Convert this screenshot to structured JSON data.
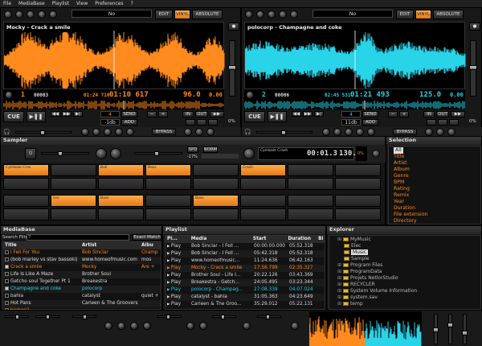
{
  "menu": [
    "File",
    "MediaBase",
    "Playlist",
    "View",
    "Preferences",
    "?"
  ],
  "colors": {
    "deck1": "#ff8a1e",
    "deck2": "#29d3e8"
  },
  "deck1": {
    "title": "Mocky - Crack a smile",
    "number": "1",
    "track_counter": "00003",
    "remain": "01:24 710",
    "elapsed": "01:10 617",
    "bpm": "96.0",
    "pitch": "0.00",
    "loop_value": "4",
    "gain_label": "-1db",
    "pitch_mode": "No",
    "abs_label": "ABSOLUTE",
    "edit_label": "EDIT",
    "vinyl_label": "VINYL",
    "cue_label": "CUE",
    "send_label": "SEND",
    "add_label": "ADD",
    "in_label": "IN",
    "out_label": "OUT",
    "bypass_label": "BYPASS",
    "pct": "0%"
  },
  "deck2": {
    "title": "polocorp - Champagne and coke",
    "number": "2",
    "track_counter": "00006",
    "remain": "02:45 531",
    "elapsed": "01:21 493",
    "bpm": "125.0",
    "pitch": "0.00",
    "loop_value": "4",
    "gain_label": "11db",
    "pitch_mode": "No",
    "abs_label": "ABSOLUTE",
    "edit_label": "EDIT",
    "vinyl_label": "VINYL",
    "cue_label": "CUE",
    "send_label": "SEND",
    "add_label": "ADD",
    "in_label": "IN",
    "out_label": "OUT",
    "bypass_label": "BYPASS",
    "pct": "0%"
  },
  "sampler": {
    "title": "Sampler",
    "spd_label": "SPD",
    "norm_label": "NORM",
    "spd_value": "-17%",
    "sample_name": "Cymbale Crash",
    "time": "00:01.3",
    "bpm": "130.5",
    "pct": "0%",
    "pad_labels": [
      "Cymbale Cras",
      "Bull",
      "Bass",
      "Crash",
      "Gnr",
      "Bass",
      "Bass",
      "Bass"
    ]
  },
  "selection": {
    "title": "Selection",
    "items": [
      "All",
      "Title",
      "Artist",
      "Album",
      "Genre",
      "BPM",
      "Rating",
      "Remix",
      "Year",
      "Duration",
      "File extension",
      "Directory"
    ]
  },
  "mediabase": {
    "title": "MediaBase",
    "search_label": "Search Filter",
    "search_value": "7",
    "exact_label": "Exact Match",
    "headers": [
      "Title",
      "Artist",
      "Albu"
    ],
    "rows": [
      {
        "title": "I Fell For You",
        "artist": "Bob Sinclar",
        "album": "Champ"
      },
      {
        "title": "(bob marley vs stav bassoki)",
        "artist": "www.homeofmusic.com",
        "album": "mos"
      },
      {
        "title": "Crack a smile",
        "artist": "Mocky",
        "album": "Are +"
      },
      {
        "title": "Life Is Like A Maze",
        "artist": "Brother Soul",
        "album": ""
      },
      {
        "title": "Getcho soul Together Pt 1",
        "artist": "Breakestra",
        "album": ""
      },
      {
        "title": "Champagne and coke",
        "artist": "polocorp",
        "album": ""
      },
      {
        "title": "bahia",
        "artist": "catalyst",
        "album": "quiet +"
      },
      {
        "title": "Hot Pans",
        "artist": "Carleen & The Groovers",
        "album": ""
      },
      {
        "title": "hiphop2",
        "artist": "",
        "album": ""
      }
    ]
  },
  "playlist": {
    "title": "Playlist",
    "headers": [
      "Pl...",
      "Media",
      "Start",
      "Duration",
      "Bi"
    ],
    "rows": [
      {
        "pl": "Play",
        "media": "Bob Sinclar - I Fell ...",
        "start": "00:00:00.000",
        "duration": "05:52.318"
      },
      {
        "pl": "Play",
        "media": "Bob Sinclar - I Fell ...",
        "start": "05:42.318",
        "duration": "05:52.318"
      },
      {
        "pl": "Play",
        "media": "www.homeofmusic...",
        "start": "11:24.636",
        "duration": "06:42.163"
      },
      {
        "pl": "Play",
        "media": "Mocky - Crack a smile",
        "start": "17:56.799",
        "duration": "02:35.327"
      },
      {
        "pl": "Play",
        "media": "Brother Soul - Life I...",
        "start": "20:22.126",
        "duration": "03:43.369"
      },
      {
        "pl": "Play",
        "media": "Breakestra - Getch...",
        "start": "24:05.495",
        "duration": "03:23.344"
      },
      {
        "pl": "Play",
        "media": "polocorp - Champag...",
        "start": "27:08.339",
        "duration": "04:07.024"
      },
      {
        "pl": "Play",
        "media": "catalyst - bahia",
        "start": "31:05.363",
        "duration": "04:23.649"
      },
      {
        "pl": "Play",
        "media": "Carleen & The Groo...",
        "start": "35:29.012",
        "duration": "05:22.131"
      }
    ]
  },
  "explorer": {
    "title": "Explorer",
    "items": [
      {
        "label": "MyMusic",
        "depth": 1
      },
      {
        "label": "Elec",
        "depth": 2
      },
      {
        "label": "Music",
        "depth": 2
      },
      {
        "label": "Sample",
        "depth": 2
      },
      {
        "label": "Program Files",
        "depth": 1
      },
      {
        "label": "ProgramData",
        "depth": 1
      },
      {
        "label": "Projets NetlorStudio",
        "depth": 1
      },
      {
        "label": "RECYCLER",
        "depth": 1
      },
      {
        "label": "System Volume Information",
        "depth": 1
      },
      {
        "label": "system.sav",
        "depth": 1
      },
      {
        "label": "temp",
        "depth": 1
      }
    ]
  }
}
